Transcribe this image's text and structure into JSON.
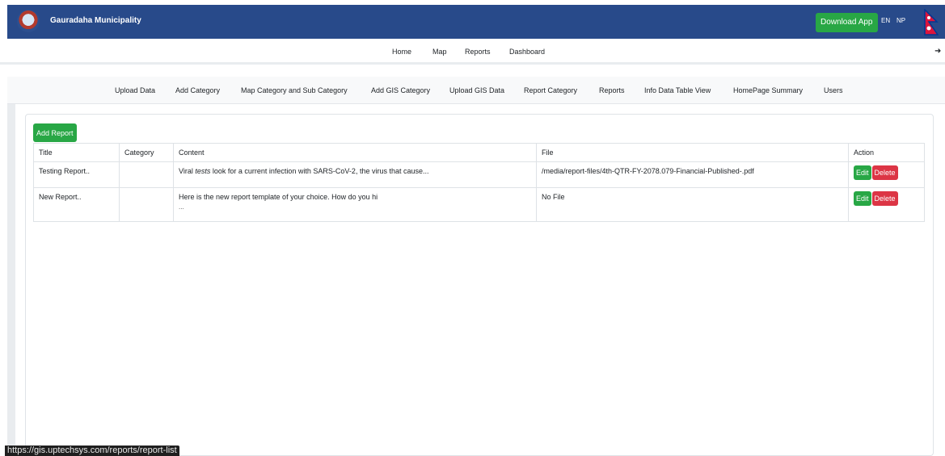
{
  "header": {
    "brand": "Gauradaha Municipality",
    "download_label": "Download App",
    "lang_en": "EN",
    "lang_np": "NP"
  },
  "main_nav": [
    "Home",
    "Map",
    "Reports",
    "Dashboard"
  ],
  "admin_nav": [
    "Upload Data",
    "Add Category",
    "Map Category and Sub Category",
    "Add GIS Category",
    "Upload GIS Data",
    "Report Category",
    "Reports",
    "Info Data Table View",
    "HomePage Summary",
    "Users"
  ],
  "content": {
    "add_report_label": "Add Report",
    "columns": [
      "Title",
      "Category",
      "Content",
      "File",
      "Action"
    ],
    "rows": [
      {
        "title": "Testing Report..",
        "category": "",
        "content_prefix": "Viral ",
        "content_em": "tests",
        "content_rest": " look for a current infection with SARS-CoV-2, the virus that cause...",
        "content_more": "",
        "file": "/media/report-files/4th-QTR-FY-2078.079-Financial-Published-.pdf"
      },
      {
        "title": "New Report..",
        "category": "",
        "content_prefix": "Here is the new report template of your choice. How do you hi",
        "content_em": "",
        "content_rest": "",
        "content_more": "...",
        "file": "No File"
      }
    ],
    "edit_label": "Edit",
    "delete_label": "Delete"
  },
  "status_url": "https://gis.uptechsys.com/reports/report-list",
  "colors": {
    "header_bg": "#284a8a",
    "success": "#28a745",
    "danger": "#dc3545"
  },
  "icons": {
    "logo": "municipality-seal-icon",
    "flag": "nepal-flag-icon",
    "logout": "logout-icon"
  }
}
